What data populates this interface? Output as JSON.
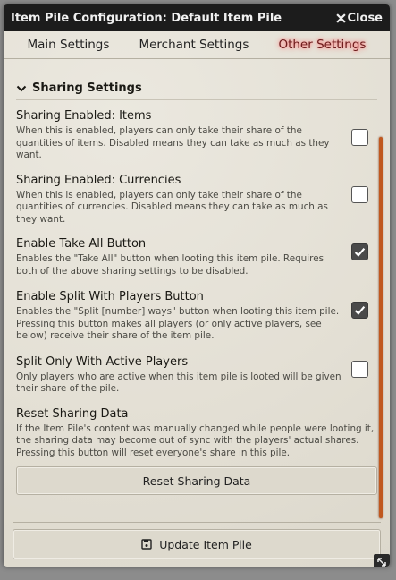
{
  "window": {
    "title": "Item Pile Configuration: Default Item Pile",
    "close_label": "Close"
  },
  "tabs": [
    {
      "label": "Main Settings",
      "active": false
    },
    {
      "label": "Merchant Settings",
      "active": false
    },
    {
      "label": "Other Settings",
      "active": true
    }
  ],
  "section": {
    "title": "Sharing Settings",
    "expanded": true
  },
  "settings": [
    {
      "label": "Sharing Enabled: Items",
      "hint": "When this is enabled, players can only take their share of the quantities of items. Disabled means they can take as much as they want.",
      "checked": false
    },
    {
      "label": "Sharing Enabled: Currencies",
      "hint": "When this is enabled, players can only take their share of the quantities of currencies. Disabled means they can take as much as they want.",
      "checked": false
    },
    {
      "label": "Enable Take All Button",
      "hint": "Enables the \"Take All\" button when looting this item pile. Requires both of the above sharing settings to be disabled.",
      "checked": true
    },
    {
      "label": "Enable Split With Players Button",
      "hint": "Enables the \"Split [number] ways\" button when looting this item pile. Pressing this button makes all players (or only active players, see below) receive their share of the item pile.",
      "checked": true
    },
    {
      "label": "Split Only With Active Players",
      "hint": "Only players who are active when this item pile is looted will be given their share of the pile.",
      "checked": false
    }
  ],
  "reset": {
    "label": "Reset Sharing Data",
    "hint": "If the Item Pile's content was manually changed while people were looting it, the sharing data may become out of sync with the players' actual shares. Pressing this button will reset everyone's share in this pile.",
    "button_label": "Reset Sharing Data"
  },
  "footer": {
    "update_label": "Update Item Pile"
  },
  "colors": {
    "active_tab": "#6b1b1b",
    "scrollbar": "#c0581f"
  }
}
